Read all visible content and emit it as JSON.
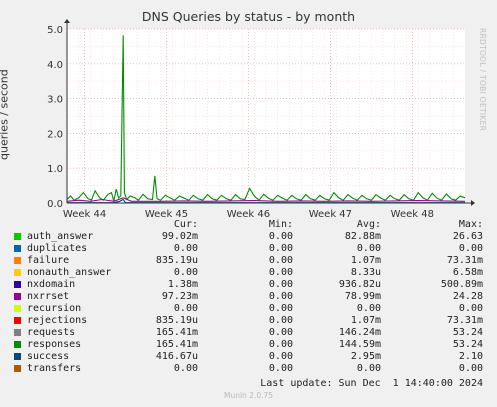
{
  "title": "DNS Queries by status - by month",
  "watermark": "RRDTOOL / TOBI OETIKER",
  "footer": "Munin 2.0.75",
  "last_update": "Last update: Sun Dec  1 14:40:00 2024",
  "legend": {
    "headers": {
      "cur": "Cur:",
      "min": "Min:",
      "avg": "Avg:",
      "max": "Max:"
    },
    "rows": [
      {
        "name": "auth_answer",
        "color": "#00cc00",
        "cur": "99.02m",
        "min": "0.00",
        "avg": "82.88m",
        "max": "26.63"
      },
      {
        "name": "duplicates",
        "color": "#0066b3",
        "cur": "0.00",
        "min": "0.00",
        "avg": "0.00",
        "max": "0.00"
      },
      {
        "name": "failure",
        "color": "#ff8000",
        "cur": "835.19u",
        "min": "0.00",
        "avg": "1.07m",
        "max": "73.31m"
      },
      {
        "name": "nonauth_answer",
        "color": "#ffcc00",
        "cur": "0.00",
        "min": "0.00",
        "avg": "8.33u",
        "max": "6.58m"
      },
      {
        "name": "nxdomain",
        "color": "#330099",
        "cur": "1.38m",
        "min": "0.00",
        "avg": "936.82u",
        "max": "500.89m"
      },
      {
        "name": "nxrrset",
        "color": "#990099",
        "cur": "97.23m",
        "min": "0.00",
        "avg": "78.99m",
        "max": "24.28"
      },
      {
        "name": "recursion",
        "color": "#ccff00",
        "cur": "0.00",
        "min": "0.00",
        "avg": "0.00",
        "max": "0.00"
      },
      {
        "name": "rejections",
        "color": "#ff0000",
        "cur": "835.19u",
        "min": "0.00",
        "avg": "1.07m",
        "max": "73.31m"
      },
      {
        "name": "requests",
        "color": "#808080",
        "cur": "165.41m",
        "min": "0.00",
        "avg": "146.24m",
        "max": "53.24"
      },
      {
        "name": "responses",
        "color": "#008f00",
        "cur": "165.41m",
        "min": "0.00",
        "avg": "144.59m",
        "max": "53.24"
      },
      {
        "name": "success",
        "color": "#00487d",
        "cur": "416.67u",
        "min": "0.00",
        "avg": "2.95m",
        "max": "2.10"
      },
      {
        "name": "transfers",
        "color": "#b35a00",
        "cur": "0.00",
        "min": "0.00",
        "avg": "0.00",
        "max": "0.00"
      }
    ]
  },
  "chart_data": {
    "type": "line",
    "title": "DNS Queries by status - by month",
    "xlabel": "",
    "ylabel": "queries / second",
    "ylim": [
      0,
      5.0
    ],
    "xlim_days": [
      0,
      34
    ],
    "yticks": [
      0,
      1.0,
      2.0,
      3.0,
      4.0,
      5.0
    ],
    "ytick_labels": [
      "0.0",
      "1.0",
      "2.0",
      "3.0",
      "4.0",
      "5.0"
    ],
    "xticks": [
      {
        "label": "Week 44",
        "day": 1.5
      },
      {
        "label": "Week 45",
        "day": 8.5
      },
      {
        "label": "Week 46",
        "day": 15.5
      },
      {
        "label": "Week 47",
        "day": 22.5
      },
      {
        "label": "Week 48",
        "day": 29.5
      }
    ],
    "grid": true,
    "series": [
      {
        "name": "responses",
        "color": "#008f00",
        "points": [
          [
            0,
            0.1
          ],
          [
            0.3,
            0.2
          ],
          [
            0.6,
            0.08
          ],
          [
            1.0,
            0.15
          ],
          [
            1.4,
            0.3
          ],
          [
            1.8,
            0.12
          ],
          [
            2.1,
            0.09
          ],
          [
            2.4,
            0.35
          ],
          [
            2.8,
            0.14
          ],
          [
            3.1,
            0.08
          ],
          [
            3.5,
            0.25
          ],
          [
            3.8,
            0.3
          ],
          [
            4.0,
            0.05
          ],
          [
            4.2,
            0.4
          ],
          [
            4.4,
            0.15
          ],
          [
            4.6,
            0.2
          ],
          [
            4.8,
            4.82
          ],
          [
            4.9,
            0.3
          ],
          [
            5.1,
            0.1
          ],
          [
            5.4,
            0.2
          ],
          [
            5.8,
            0.15
          ],
          [
            6.1,
            0.08
          ],
          [
            6.5,
            0.25
          ],
          [
            6.9,
            0.12
          ],
          [
            7.3,
            0.1
          ],
          [
            7.5,
            0.78
          ],
          [
            7.7,
            0.12
          ],
          [
            8.0,
            0.08
          ],
          [
            8.4,
            0.22
          ],
          [
            8.8,
            0.15
          ],
          [
            9.2,
            0.08
          ],
          [
            9.6,
            0.2
          ],
          [
            10.0,
            0.14
          ],
          [
            10.4,
            0.08
          ],
          [
            10.8,
            0.22
          ],
          [
            11.2,
            0.12
          ],
          [
            11.6,
            0.08
          ],
          [
            12.0,
            0.24
          ],
          [
            12.4,
            0.12
          ],
          [
            12.8,
            0.08
          ],
          [
            13.2,
            0.22
          ],
          [
            13.6,
            0.12
          ],
          [
            14.0,
            0.08
          ],
          [
            14.4,
            0.24
          ],
          [
            14.8,
            0.12
          ],
          [
            15.2,
            0.1
          ],
          [
            15.6,
            0.42
          ],
          [
            16.0,
            0.2
          ],
          [
            16.4,
            0.08
          ],
          [
            16.8,
            0.25
          ],
          [
            17.2,
            0.14
          ],
          [
            17.6,
            0.08
          ],
          [
            18.0,
            0.22
          ],
          [
            18.4,
            0.14
          ],
          [
            18.8,
            0.08
          ],
          [
            19.2,
            0.22
          ],
          [
            19.6,
            0.12
          ],
          [
            20.0,
            0.08
          ],
          [
            20.4,
            0.24
          ],
          [
            20.8,
            0.12
          ],
          [
            21.2,
            0.08
          ],
          [
            21.6,
            0.22
          ],
          [
            22.0,
            0.12
          ],
          [
            22.4,
            0.08
          ],
          [
            22.8,
            0.3
          ],
          [
            23.2,
            0.15
          ],
          [
            23.6,
            0.08
          ],
          [
            24.0,
            0.24
          ],
          [
            24.4,
            0.14
          ],
          [
            24.8,
            0.08
          ],
          [
            25.2,
            0.22
          ],
          [
            25.6,
            0.12
          ],
          [
            26.0,
            0.08
          ],
          [
            26.4,
            0.24
          ],
          [
            26.8,
            0.14
          ],
          [
            27.2,
            0.08
          ],
          [
            27.6,
            0.22
          ],
          [
            28.0,
            0.12
          ],
          [
            28.4,
            0.08
          ],
          [
            28.8,
            0.24
          ],
          [
            29.2,
            0.12
          ],
          [
            29.6,
            0.08
          ],
          [
            30.0,
            0.3
          ],
          [
            30.4,
            0.15
          ],
          [
            30.8,
            0.08
          ],
          [
            31.2,
            0.28
          ],
          [
            31.6,
            0.14
          ],
          [
            32.0,
            0.08
          ],
          [
            32.4,
            0.26
          ],
          [
            32.8,
            0.12
          ],
          [
            33.2,
            0.08
          ],
          [
            33.6,
            0.2
          ],
          [
            34.0,
            0.15
          ]
        ]
      },
      {
        "name": "nxrrset",
        "color": "#990099",
        "points": [
          [
            0,
            0.05
          ],
          [
            1.0,
            0.08
          ],
          [
            2.0,
            0.05
          ],
          [
            3.0,
            0.1
          ],
          [
            4.0,
            0.05
          ],
          [
            4.8,
            0.15
          ],
          [
            5.5,
            0.05
          ],
          [
            7.0,
            0.05
          ],
          [
            8.0,
            0.05
          ],
          [
            10.0,
            0.06
          ],
          [
            12.0,
            0.05
          ],
          [
            14.0,
            0.06
          ],
          [
            16.0,
            0.07
          ],
          [
            18.0,
            0.05
          ],
          [
            20.0,
            0.06
          ],
          [
            22.0,
            0.05
          ],
          [
            24.0,
            0.06
          ],
          [
            26.0,
            0.05
          ],
          [
            28.0,
            0.06
          ],
          [
            30.0,
            0.07
          ],
          [
            32.0,
            0.06
          ],
          [
            34.0,
            0.05
          ]
        ]
      },
      {
        "name": "success",
        "color": "#00487d",
        "points": [
          [
            0,
            0.01
          ],
          [
            4.0,
            0.01
          ],
          [
            4.5,
            0.05
          ],
          [
            4.8,
            0.1
          ],
          [
            5.0,
            0.01
          ],
          [
            10,
            0.01
          ],
          [
            20,
            0.01
          ],
          [
            34,
            0.01
          ]
        ]
      }
    ]
  }
}
